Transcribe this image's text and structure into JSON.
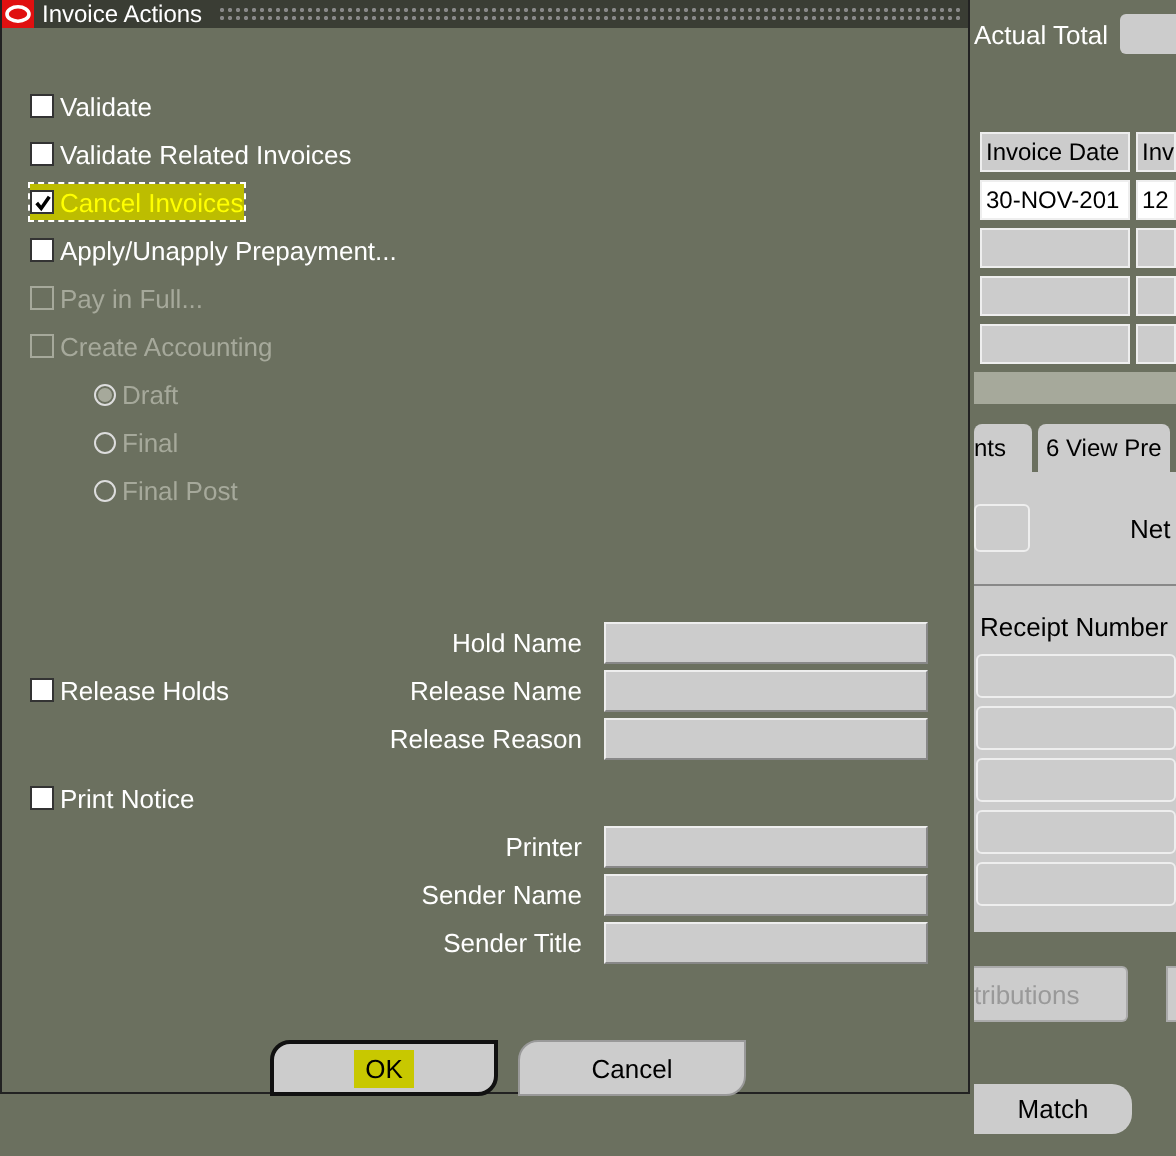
{
  "background": {
    "actual_total_label": "Actual Total",
    "invoice_table": {
      "columns": [
        "Invoice Date",
        "Inv"
      ],
      "rows": [
        {
          "kind": "data",
          "cells": [
            "30-NOV-201",
            "12"
          ]
        },
        {
          "kind": "blank"
        },
        {
          "kind": "blank"
        },
        {
          "kind": "blank"
        }
      ]
    },
    "tabs": [
      {
        "label": "nts",
        "selected": false
      },
      {
        "label": "6 View Pre",
        "selected": false
      }
    ],
    "net_label": "Net",
    "receipt_table": {
      "columns": [
        "Receipt Number"
      ],
      "rows": [
        {
          "kind": "blank"
        },
        {
          "kind": "blank"
        },
        {
          "kind": "blank"
        },
        {
          "kind": "blank"
        },
        {
          "kind": "blank"
        }
      ]
    },
    "buttons": [
      {
        "label": "tributions",
        "disabled": true
      },
      {
        "label": "Match",
        "disabled": false
      }
    ]
  },
  "dialog": {
    "title": "Invoice Actions",
    "options": [
      {
        "kind": "checkbox",
        "label": "Validate",
        "checked": false,
        "disabled": false,
        "focused": false
      },
      {
        "kind": "checkbox",
        "label": "Validate Related Invoices",
        "checked": false,
        "disabled": false,
        "focused": false
      },
      {
        "kind": "checkbox",
        "label": "Cancel Invoices",
        "checked": true,
        "disabled": false,
        "focused": true
      },
      {
        "kind": "checkbox",
        "label": "Apply/Unapply Prepayment...",
        "checked": false,
        "disabled": false,
        "focused": false
      },
      {
        "kind": "checkbox",
        "label": "Pay in Full...",
        "checked": false,
        "disabled": true,
        "focused": false
      },
      {
        "kind": "checkbox",
        "label": "Create Accounting",
        "checked": false,
        "disabled": true,
        "focused": false
      },
      {
        "kind": "radio",
        "label": "Draft",
        "selected": true,
        "disabled": true,
        "focused": false
      },
      {
        "kind": "radio",
        "label": "Final",
        "selected": false,
        "disabled": true,
        "focused": false
      },
      {
        "kind": "radio",
        "label": "Final Post",
        "selected": false,
        "disabled": true,
        "focused": false
      }
    ],
    "groups": [
      {
        "kind": "beside",
        "checkbox": {
          "label": "Release Holds",
          "checked": false
        },
        "fields": [
          {
            "label": "Hold Name"
          },
          {
            "label": "Release Name"
          },
          {
            "label": "Release Reason"
          }
        ]
      },
      {
        "kind": "above",
        "checkbox": {
          "label": "Print Notice",
          "checked": false
        },
        "fields": [
          {
            "label": "Printer"
          },
          {
            "label": "Sender Name"
          },
          {
            "label": "Sender Title"
          }
        ]
      }
    ],
    "buttons": [
      {
        "label": "OK",
        "focused": true
      },
      {
        "label": "Cancel",
        "focused": false
      }
    ]
  }
}
